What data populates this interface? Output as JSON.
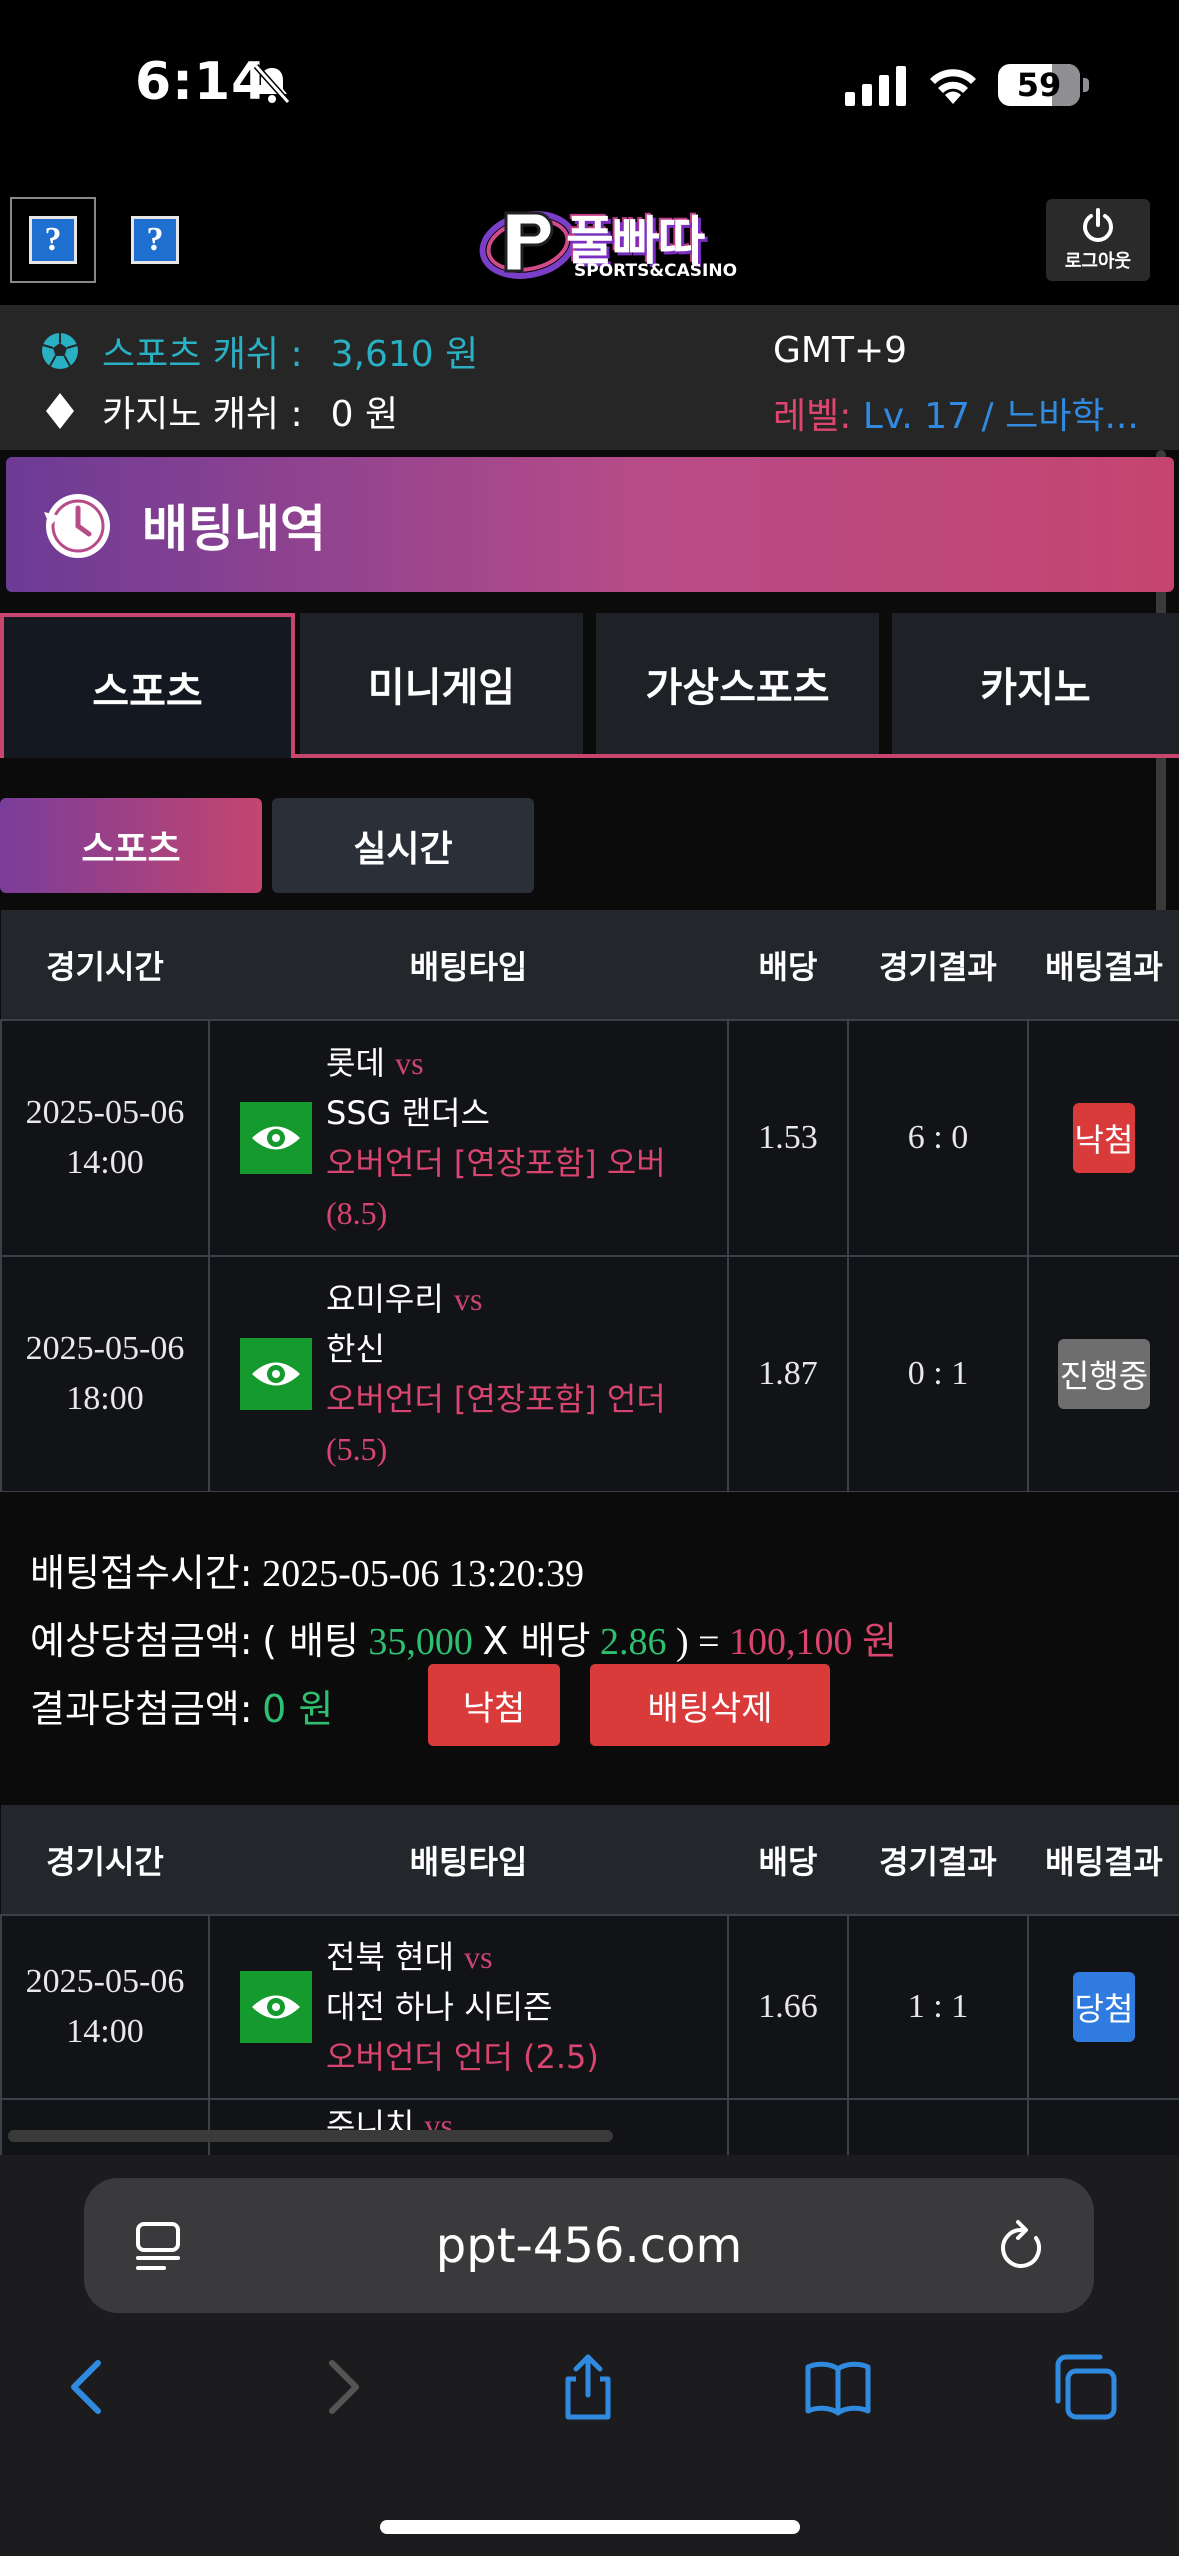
{
  "status_bar": {
    "time": "6:14",
    "battery": "59"
  },
  "header": {
    "help_1": "?",
    "help_2": "?",
    "logo_text": "풀빠따",
    "logo_sub": "SPORTS&CASINO",
    "logout_label": "로그아웃"
  },
  "account": {
    "sports_cash_label": "스포츠 캐쉬 :",
    "sports_cash_value": "3,610 원",
    "casino_cash_label": "카지노 캐쉬 :",
    "casino_cash_value": "0 원",
    "timezone": "GMT+9",
    "level_label": "레벨:",
    "level_value": "Lv. 17 / 느바학..."
  },
  "page_title": "배팅내역",
  "tabs": [
    "스포츠",
    "미니게임",
    "가상스포츠",
    "카지노"
  ],
  "subtabs": [
    "스포츠",
    "실시간"
  ],
  "table_headers": [
    "경기시간",
    "배팅타입",
    "배당",
    "경기결과",
    "배팅결과"
  ],
  "slip_1": {
    "rows": [
      {
        "date": "2025-05-06",
        "time": "14:00",
        "home": "롯데",
        "vs": "vs",
        "away": "SSG 랜더스",
        "market": "오버언더 [연장포함] 오버",
        "line": "(8.5)",
        "odds": "1.53",
        "score": "6 : 0",
        "result": "낙첨"
      },
      {
        "date": "2025-05-06",
        "time": "18:00",
        "home": "요미우리",
        "vs": "vs",
        "away": "한신",
        "market": "오버언더 [연장포함] 언더",
        "line": "(5.5)",
        "odds": "1.87",
        "score": "0 : 1",
        "result": "진행중"
      }
    ],
    "accept_label": "배팅접수시간:",
    "accept_time": "2025-05-06 13:20:39",
    "expected_label": "예상당첨금액:",
    "expected_open": "( 배팅",
    "stake": "35,000",
    "x_label": "X 배당",
    "total_odds": "2.86",
    "expected_close": ") =",
    "expected_win": "100,100 원",
    "result_label": "결과당첨금액:",
    "result_amount": "0 원",
    "status_button": "낙첨",
    "delete_button": "배팅삭제"
  },
  "slip_2": {
    "rows": [
      {
        "date": "2025-05-06",
        "time": "14:00",
        "home": "전북 현대",
        "vs": "vs",
        "away": "대전 하나 시티즌",
        "market": "오버언더 언더 (2.5)",
        "odds": "1.66",
        "score": "1 : 1",
        "result": "당첨"
      }
    ],
    "partial_home": "주니치",
    "partial_vs": "vs"
  },
  "browser": {
    "url": "ppt-456.com"
  }
}
